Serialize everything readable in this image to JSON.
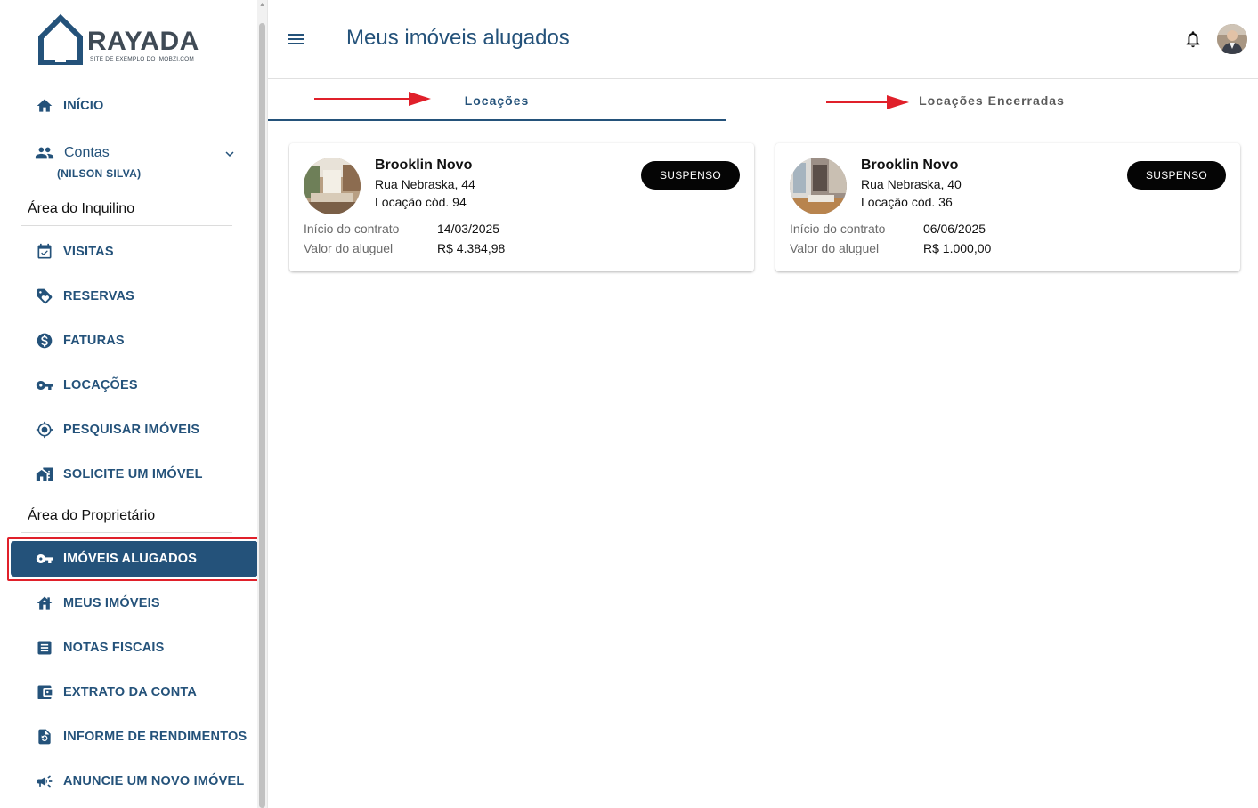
{
  "brand": {
    "name": "RAYADA",
    "tagline": "SITE DE EXEMPLO DO IMOBZI.COM",
    "color": "#24527a"
  },
  "sidebar": {
    "inicio": "INÍCIO",
    "contas": {
      "label": "Contas",
      "user": "(NILSON SILVA)"
    },
    "section_inquilino": "Área do Inquilino",
    "inquilino_items": [
      {
        "label": "VISITAS",
        "icon": "calendar-check-icon"
      },
      {
        "label": "RESERVAS",
        "icon": "tag-heart-icon"
      },
      {
        "label": "FATURAS",
        "icon": "dollar-circle-icon"
      },
      {
        "label": "LOCAÇÕES",
        "icon": "key-icon"
      },
      {
        "label": "PESQUISAR IMÓVEIS",
        "icon": "crosshair-icon"
      },
      {
        "label": "SOLICITE UM IMÓVEL",
        "icon": "house-request-icon"
      }
    ],
    "section_proprietario": "Área do Proprietário",
    "proprietario_items": [
      {
        "label": "IMÓVEIS ALUGADOS",
        "icon": "key-icon",
        "active": true
      },
      {
        "label": "MEUS IMÓVEIS",
        "icon": "house-icon"
      },
      {
        "label": "NOTAS FISCAIS",
        "icon": "receipt-icon"
      },
      {
        "label": "EXTRATO DA CONTA",
        "icon": "wallet-icon"
      },
      {
        "label": "INFORME DE RENDIMENTOS",
        "icon": "document-refresh-icon"
      },
      {
        "label": "ANUNCIE UM NOVO IMÓVEL",
        "icon": "megaphone-icon"
      }
    ]
  },
  "header": {
    "title": "Meus imóveis alugados"
  },
  "tabs": [
    {
      "label": "Locações",
      "active": true
    },
    {
      "label": "Locações Encerradas",
      "active": false
    }
  ],
  "cards": [
    {
      "title": "Brooklin Novo",
      "address": "Rua Nebraska, 44",
      "code": "Locação cód. 94",
      "status": "SUSPENSO",
      "contract_label": "Início do contrato",
      "contract_value": "14/03/2025",
      "rent_label": "Valor do aluguel",
      "rent_value": "R$ 4.384,98"
    },
    {
      "title": "Brooklin Novo",
      "address": "Rua Nebraska, 40",
      "code": "Locação cód. 36",
      "status": "SUSPENSO",
      "contract_label": "Início do contrato",
      "contract_value": "06/06/2025",
      "rent_label": "Valor do aluguel",
      "rent_value": "R$ 1.000,00"
    }
  ],
  "colors": {
    "accent": "#24527a",
    "annotation": "#e0202a",
    "badge": "#050505"
  }
}
